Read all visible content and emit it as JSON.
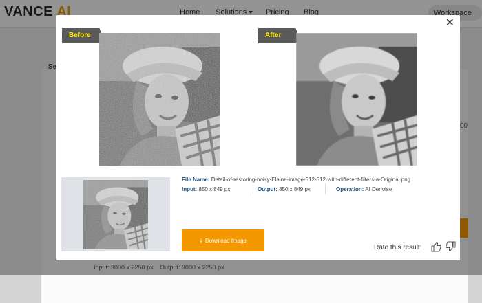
{
  "brand": {
    "logo_main": "VANCE",
    "logo_accent": "AI"
  },
  "nav": {
    "home": "Home",
    "solutions": "Solutions",
    "pricing": "Pricing",
    "blog": "Blog",
    "workspace": "Workspace"
  },
  "background": {
    "left_label": "Se",
    "right_number": "00",
    "input_text": "Input: 3000 x 2250 px",
    "output_text": "Output: 3000 x 2250 px"
  },
  "modal": {
    "before_label": "Before",
    "after_label": "After",
    "file_name_label": "File Name:",
    "file_name": "Detail-of-restoring-noisy-Elaine-image-512-512-with-different-filters-a-Original.png",
    "input_label": "Input:",
    "input_value": "850 x 849 px",
    "output_label": "Output:",
    "output_value": "850 x 849 px",
    "operation_label": "Operation:",
    "operation_value": "AI Denoise",
    "download_label": "Download Image",
    "rate_label": "Rate this result:"
  },
  "colors": {
    "accent": "#f39800",
    "tag_text": "#ffe800",
    "tag_bg": "#5a5a5a",
    "info_key": "#1c4f7c"
  },
  "icons": {
    "close": "close-icon",
    "download": "download-icon",
    "like": "thumbs-up-icon",
    "dislike": "thumbs-down-icon"
  }
}
